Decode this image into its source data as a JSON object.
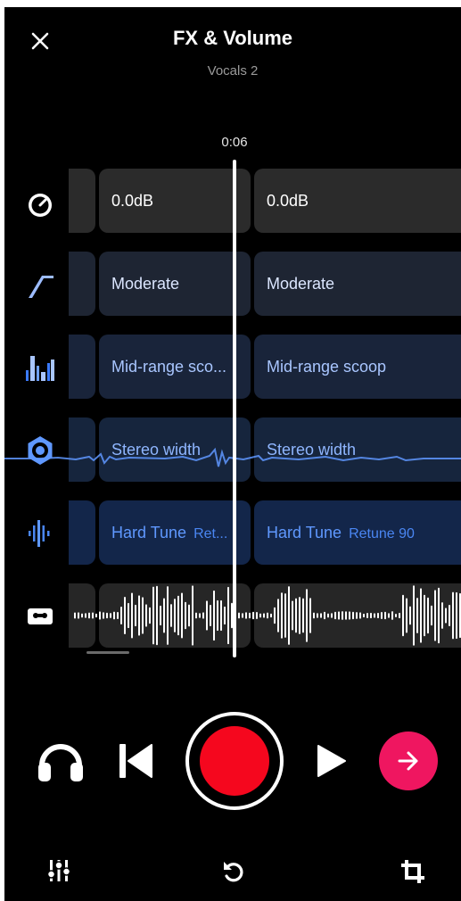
{
  "header": {
    "title": "FX & Volume",
    "subtitle": "Vocals 2"
  },
  "playhead": {
    "time": "0:06"
  },
  "rows": {
    "gain": {
      "icon": "gauge-icon",
      "clip1": "0.0dB",
      "clip2": "0.0dB"
    },
    "comp": {
      "icon": "compressor-curve-icon",
      "clip1": "Moderate",
      "clip2": "Moderate"
    },
    "eq": {
      "icon": "eq-bars-icon",
      "clip1": "Mid-range sco...",
      "clip2": "Mid-range scoop"
    },
    "stereo": {
      "icon": "stereo-ring-icon",
      "clip1": "Stereo width",
      "clip2": "Stereo width"
    },
    "tune": {
      "icon": "pitch-wave-icon",
      "clip1": "Hard Tune",
      "clip1_sub": "Ret...",
      "clip2": "Hard Tune",
      "clip2_sub": "Retune 90"
    },
    "audio": {
      "icon": "cassette-icon"
    }
  },
  "colors": {
    "record": "#f5071e",
    "next": "#ef1660",
    "tune_text": "#5f98ff"
  }
}
